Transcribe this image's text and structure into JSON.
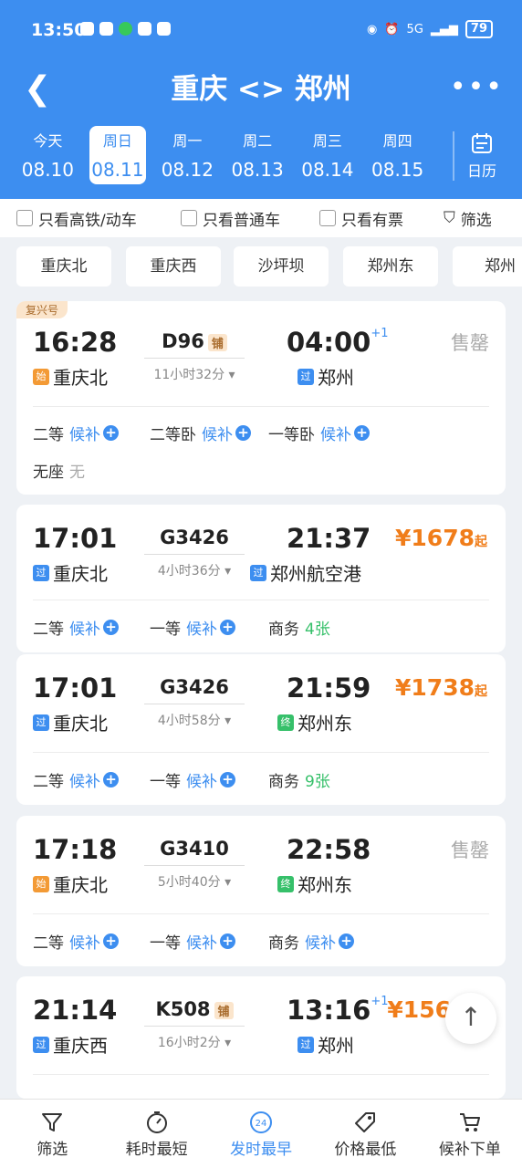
{
  "status_bar": {
    "time": "13:50",
    "network": "5G",
    "battery": "79"
  },
  "header": {
    "title": "重庆 <> 郑州",
    "more": "•••"
  },
  "dates": [
    {
      "weekday": "今天",
      "date": "08.10"
    },
    {
      "weekday": "周日",
      "date": "08.11"
    },
    {
      "weekday": "周一",
      "date": "08.12"
    },
    {
      "weekday": "周二",
      "date": "08.13"
    },
    {
      "weekday": "周三",
      "date": "08.14"
    },
    {
      "weekday": "周四",
      "date": "08.15"
    }
  ],
  "selected_date_index": 1,
  "calendar_label": "日历",
  "filters": {
    "high_speed": "只看高铁/动车",
    "normal": "只看普通车",
    "available": "只看有票",
    "screen": "筛选"
  },
  "stations": [
    "重庆北",
    "重庆西",
    "沙坪坝",
    "郑州东",
    "郑州"
  ],
  "trains": [
    {
      "tag": "复兴号",
      "dep_time": "16:28",
      "arr_time": "04:00",
      "day_plus": "+1",
      "train_no": "D96",
      "sleeper_badge": "铺",
      "duration": "11小时32分",
      "dep_mark": "始",
      "dep_station": "重庆北",
      "arr_mark": "过",
      "arr_station": "郑州",
      "status": "售罄",
      "seats": [
        {
          "name": "二等",
          "value": "候补"
        },
        {
          "name": "二等卧",
          "value": "候补"
        },
        {
          "name": "一等卧",
          "value": "候补"
        },
        {
          "name": "无座",
          "value": "无"
        }
      ]
    },
    {
      "dep_time": "17:01",
      "arr_time": "21:37",
      "train_no": "G3426",
      "duration": "4小时36分",
      "dep_mark": "过",
      "dep_station": "重庆北",
      "arr_mark": "过",
      "arr_station": "郑州航空港",
      "price": "¥1678",
      "price_suffix": "起",
      "seats": [
        {
          "name": "二等",
          "value": "候补"
        },
        {
          "name": "一等",
          "value": "候补"
        },
        {
          "name": "商务",
          "value": "4张"
        }
      ]
    },
    {
      "dep_time": "17:01",
      "arr_time": "21:59",
      "train_no": "G3426",
      "duration": "4小时58分",
      "dep_mark": "过",
      "dep_station": "重庆北",
      "arr_mark": "终",
      "arr_station": "郑州东",
      "price": "¥1738",
      "price_suffix": "起",
      "seats": [
        {
          "name": "二等",
          "value": "候补"
        },
        {
          "name": "一等",
          "value": "候补"
        },
        {
          "name": "商务",
          "value": "9张"
        }
      ]
    },
    {
      "dep_time": "17:18",
      "arr_time": "22:58",
      "train_no": "G3410",
      "duration": "5小时40分",
      "dep_mark": "始",
      "dep_station": "重庆北",
      "arr_mark": "终",
      "arr_station": "郑州东",
      "status": "售罄",
      "seats": [
        {
          "name": "二等",
          "value": "候补"
        },
        {
          "name": "一等",
          "value": "候补"
        },
        {
          "name": "商务",
          "value": "候补"
        }
      ]
    },
    {
      "dep_time": "21:14",
      "arr_time": "13:16",
      "day_plus": "+1",
      "train_no": "K508",
      "sleeper_badge": "铺",
      "duration": "16小时2分",
      "dep_mark": "过",
      "dep_station": "重庆西",
      "arr_mark": "过",
      "arr_station": "郑州",
      "price": "¥156"
    }
  ],
  "plus_icon": "+",
  "scroll_top_icon": "↑",
  "bottom_tabs": [
    {
      "label": "筛选",
      "icon": "filter-icon"
    },
    {
      "label": "耗时最短",
      "icon": "timer-icon"
    },
    {
      "label": "发时最早",
      "icon": "clock-24-icon",
      "badge": "24"
    },
    {
      "label": "价格最低",
      "icon": "price-tag-icon"
    },
    {
      "label": "候补下单",
      "icon": "cart-icon"
    }
  ],
  "colors": {
    "primary": "#3d8ef0",
    "price": "#f07d1a",
    "available": "#36c06a",
    "origin_mark": "#f39a35"
  }
}
